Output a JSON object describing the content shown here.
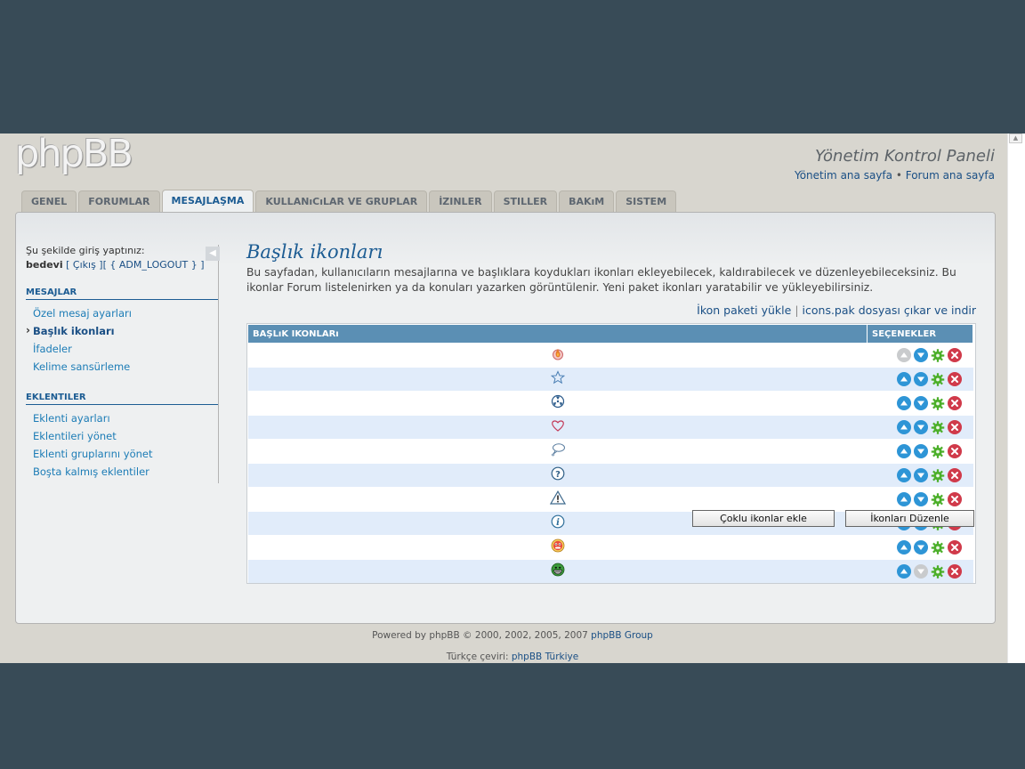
{
  "header": {
    "logo": "phpBB",
    "panel_title": "Yönetim Kontrol Paneli",
    "link_admin_home": "Yönetim ana sayfa",
    "separator": "•",
    "link_forum_home": "Forum ana sayfa"
  },
  "tabs": [
    {
      "label": "GENEL"
    },
    {
      "label": "FORUMLAR"
    },
    {
      "label": "MESAJLAŞMA"
    },
    {
      "label": "KULLANıCıLAR VE GRUPLAR"
    },
    {
      "label": "İZINLER"
    },
    {
      "label": "STILLER"
    },
    {
      "label": "BAKıM"
    },
    {
      "label": "SISTEM"
    }
  ],
  "sidebar": {
    "login_label": "Şu şekilde giriş yaptınız:",
    "username": "bedevi",
    "logout_text": "[ Çıkış ][ { ADM_LOGOUT } ]",
    "collapse_icon": "arrow-left-icon",
    "sections": [
      {
        "title": "MESAJLAR",
        "items": [
          "Özel mesaj ayarları",
          "Başlık ikonları",
          "İfadeler",
          "Kelime sansürleme"
        ]
      },
      {
        "title": "EKLENTILER",
        "items": [
          "Eklenti ayarları",
          "Eklentileri yönet",
          "Eklenti gruplarını yönet",
          "Boşta kalmış eklentiler"
        ]
      }
    ]
  },
  "main": {
    "title": "Başlık ikonları",
    "description": "Bu sayfadan, kullanıcıların mesajlarına ve başlıklara koydukları ikonları ekleyebilecek, kaldırabilecek ve düzenleyebileceksiniz. Bu ikonlar Forum listelenirken ya da konuları yazarken görüntülenir. Yeni paket ikonları yaratabilir ve yükleyebilirsiniz.",
    "action_upload": "İkon paketi yükle",
    "action_sep": "|",
    "action_export": "icons.pak dosyası çıkar ve indir",
    "table": {
      "col_icons": "BAŞLıK IKONLARı",
      "col_options": "SEÇENEKLER",
      "rows": [
        {
          "icon": "fire-icon",
          "up_disabled": true,
          "down_disabled": false
        },
        {
          "icon": "star-icon",
          "up_disabled": false,
          "down_disabled": false
        },
        {
          "icon": "radioactive-icon",
          "up_disabled": false,
          "down_disabled": false
        },
        {
          "icon": "heart-icon",
          "up_disabled": false,
          "down_disabled": false
        },
        {
          "icon": "speech-bubble-icon",
          "up_disabled": false,
          "down_disabled": false
        },
        {
          "icon": "question-icon",
          "up_disabled": false,
          "down_disabled": false
        },
        {
          "icon": "warning-icon",
          "up_disabled": false,
          "down_disabled": false
        },
        {
          "icon": "info-icon",
          "up_disabled": false,
          "down_disabled": false
        },
        {
          "icon": "smiley-red-icon",
          "up_disabled": false,
          "down_disabled": false
        },
        {
          "icon": "smiley-green-grin-icon",
          "up_disabled": false,
          "down_disabled": true
        }
      ]
    },
    "button_add_multiple": "Çoklu ikonlar ekle",
    "button_edit_icons": "İkonları Düzenle"
  },
  "footer": {
    "powered_prefix": "Powered by phpBB © 2000, 2002, 2005, 2007",
    "powered_link": "phpBB Group",
    "translation_prefix": "Türkçe çeviri:",
    "translation_link": "phpBB Türkiye"
  },
  "colors": {
    "accent": "#1c5c93",
    "table_header": "#5b8fb4",
    "row_alt": "#e1ecfa",
    "delete": "#d03a4a",
    "move": "#2e95d6",
    "edit": "#4caf2a"
  }
}
